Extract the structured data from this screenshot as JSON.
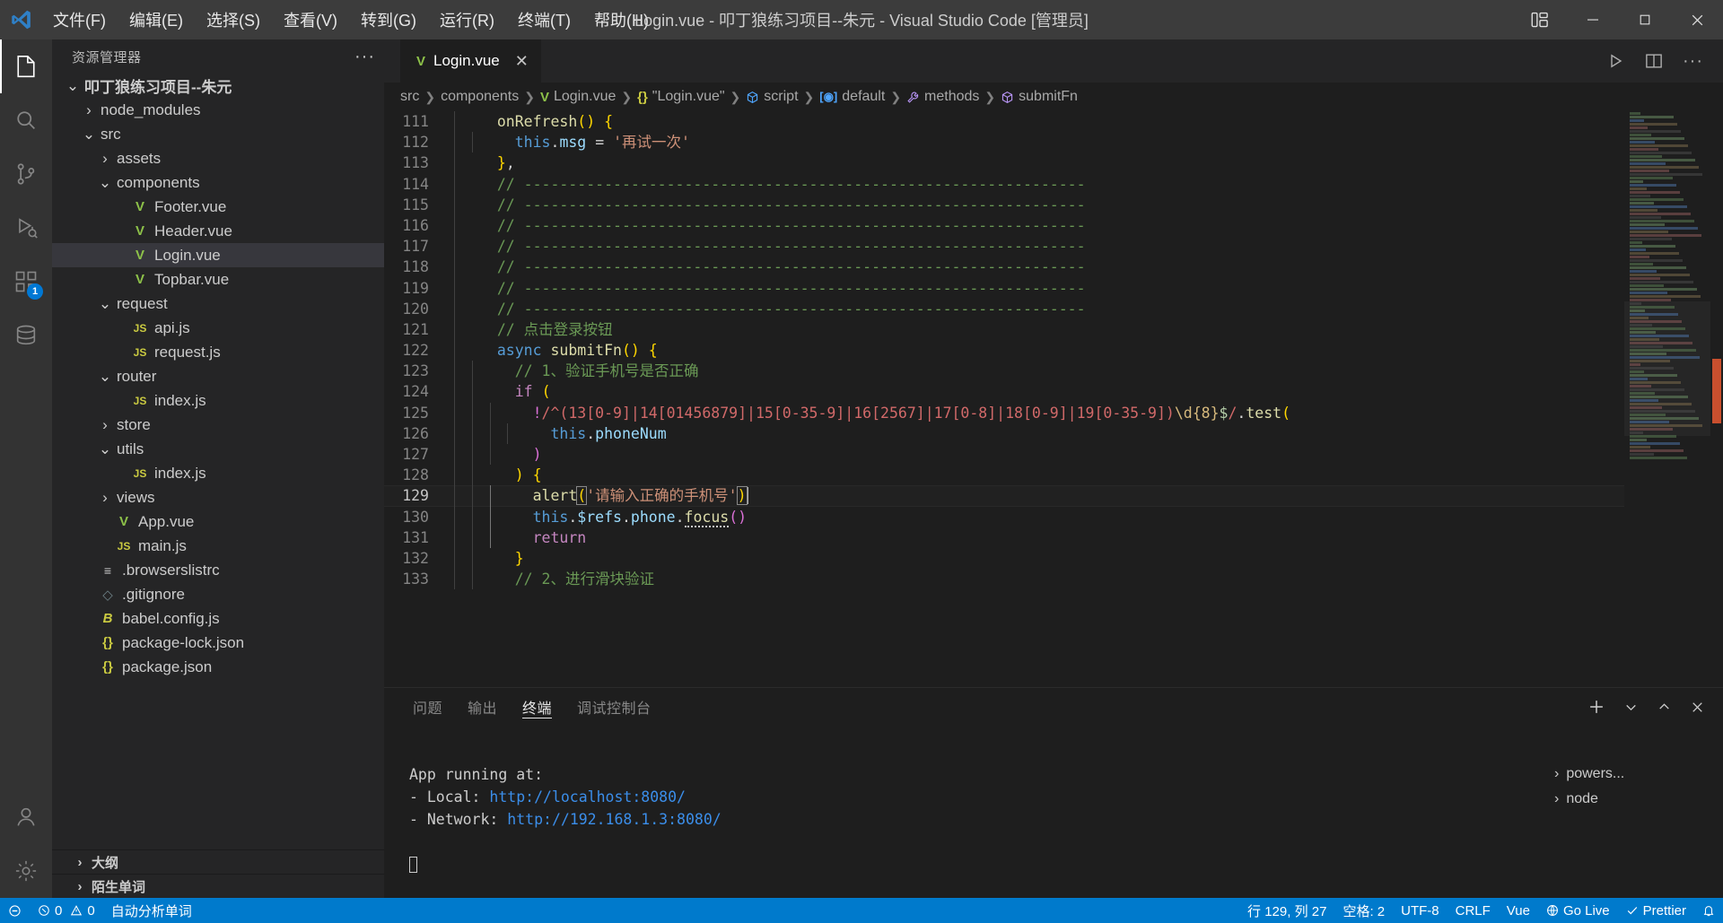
{
  "titlebar": {
    "menus": [
      "文件(F)",
      "编辑(E)",
      "选择(S)",
      "查看(V)",
      "转到(G)",
      "运行(R)",
      "终端(T)",
      "帮助(H)"
    ],
    "title": "Login.vue - 叩丁狼练习项目--朱元 - Visual Studio Code [管理员]",
    "controls": {
      "layout": "layout-icon",
      "minimize": "─",
      "maximize": "▢",
      "close": "✕"
    }
  },
  "activitybar": {
    "items": [
      {
        "name": "explorer-icon",
        "label": "资源管理器",
        "active": true,
        "badge": ""
      },
      {
        "name": "search-icon",
        "label": "搜索",
        "active": false,
        "badge": ""
      },
      {
        "name": "source-control-icon",
        "label": "源代码管理",
        "active": false,
        "badge": ""
      },
      {
        "name": "run-debug-icon",
        "label": "运行和调试",
        "active": false,
        "badge": ""
      },
      {
        "name": "extensions-icon",
        "label": "扩展",
        "active": false,
        "badge": "1"
      },
      {
        "name": "remote-explorer-icon",
        "label": "远程资源管理器",
        "active": false,
        "badge": ""
      }
    ],
    "bottom": [
      {
        "name": "account-icon",
        "label": "账户"
      },
      {
        "name": "gear-icon",
        "label": "管理"
      }
    ]
  },
  "sidebar": {
    "header": "资源管理器",
    "header_more": "···",
    "tree": [
      {
        "label": "叩丁狼练习项目--朱元",
        "indent": 0,
        "twisty": "down",
        "icon": "",
        "bold": true,
        "selected": false
      },
      {
        "label": "node_modules",
        "indent": 1,
        "twisty": "right",
        "icon": "",
        "bold": false,
        "selected": false
      },
      {
        "label": "src",
        "indent": 1,
        "twisty": "down",
        "icon": "",
        "bold": false,
        "selected": false
      },
      {
        "label": "assets",
        "indent": 2,
        "twisty": "right",
        "icon": "",
        "bold": false,
        "selected": false
      },
      {
        "label": "components",
        "indent": 2,
        "twisty": "down",
        "icon": "",
        "bold": false,
        "selected": false
      },
      {
        "label": "Footer.vue",
        "indent": 3,
        "twisty": "",
        "icon": "vue",
        "bold": false,
        "selected": false
      },
      {
        "label": "Header.vue",
        "indent": 3,
        "twisty": "",
        "icon": "vue",
        "bold": false,
        "selected": false
      },
      {
        "label": "Login.vue",
        "indent": 3,
        "twisty": "",
        "icon": "vue",
        "bold": false,
        "selected": true
      },
      {
        "label": "Topbar.vue",
        "indent": 3,
        "twisty": "",
        "icon": "vue",
        "bold": false,
        "selected": false
      },
      {
        "label": "request",
        "indent": 2,
        "twisty": "down",
        "icon": "",
        "bold": false,
        "selected": false
      },
      {
        "label": "api.js",
        "indent": 3,
        "twisty": "",
        "icon": "js",
        "bold": false,
        "selected": false
      },
      {
        "label": "request.js",
        "indent": 3,
        "twisty": "",
        "icon": "js",
        "bold": false,
        "selected": false
      },
      {
        "label": "router",
        "indent": 2,
        "twisty": "down",
        "icon": "",
        "bold": false,
        "selected": false
      },
      {
        "label": "index.js",
        "indent": 3,
        "twisty": "",
        "icon": "js",
        "bold": false,
        "selected": false
      },
      {
        "label": "store",
        "indent": 2,
        "twisty": "right",
        "icon": "",
        "bold": false,
        "selected": false
      },
      {
        "label": "utils",
        "indent": 2,
        "twisty": "down",
        "icon": "",
        "bold": false,
        "selected": false
      },
      {
        "label": "index.js",
        "indent": 3,
        "twisty": "",
        "icon": "js",
        "bold": false,
        "selected": false
      },
      {
        "label": "views",
        "indent": 2,
        "twisty": "right",
        "icon": "",
        "bold": false,
        "selected": false
      },
      {
        "label": "App.vue",
        "indent": 2,
        "twisty": "",
        "icon": "vue",
        "bold": false,
        "selected": false
      },
      {
        "label": "main.js",
        "indent": 2,
        "twisty": "",
        "icon": "js",
        "bold": false,
        "selected": false
      },
      {
        "label": ".browserslistrc",
        "indent": 1,
        "twisty": "",
        "icon": "cfg",
        "bold": false,
        "selected": false
      },
      {
        "label": ".gitignore",
        "indent": 1,
        "twisty": "",
        "icon": "git",
        "bold": false,
        "selected": false
      },
      {
        "label": "babel.config.js",
        "indent": 1,
        "twisty": "",
        "icon": "babel",
        "bold": false,
        "selected": false
      },
      {
        "label": "package-lock.json",
        "indent": 1,
        "twisty": "",
        "icon": "json",
        "bold": false,
        "selected": false
      },
      {
        "label": "package.json",
        "indent": 1,
        "twisty": "",
        "icon": "json",
        "bold": false,
        "selected": false
      }
    ],
    "sections": [
      {
        "label": "大纲",
        "twisty": "right"
      },
      {
        "label": "陌生单词",
        "twisty": "right"
      }
    ]
  },
  "editor": {
    "tab": {
      "label": "Login.vue",
      "icon": "vue-icon",
      "close": "✕"
    },
    "tab_actions": [
      "run-icon",
      "split-editor-icon",
      "more-actions-icon"
    ],
    "breadcrumbs": [
      {
        "label": "src",
        "icon": ""
      },
      {
        "label": "components",
        "icon": ""
      },
      {
        "label": "Login.vue",
        "icon": "vue"
      },
      {
        "label": "\"Login.vue\"",
        "icon": "json"
      },
      {
        "label": "script",
        "icon": "cube-blue"
      },
      {
        "label": "default",
        "icon": "field"
      },
      {
        "label": "methods",
        "icon": "wrench"
      },
      {
        "label": "submitFn",
        "icon": "cube-purple"
      }
    ],
    "first_line": 111,
    "current_line": 129,
    "lines": [
      {
        "n": 111,
        "text": "  onRefresh() {"
      },
      {
        "n": 112,
        "text": "    this.msg = '再试一次'"
      },
      {
        "n": 113,
        "text": "  },"
      },
      {
        "n": 114,
        "text": "  // ---------------------------------------------------------------"
      },
      {
        "n": 115,
        "text": "  // ---------------------------------------------------------------"
      },
      {
        "n": 116,
        "text": "  // ---------------------------------------------------------------"
      },
      {
        "n": 117,
        "text": "  // ---------------------------------------------------------------"
      },
      {
        "n": 118,
        "text": "  // ---------------------------------------------------------------"
      },
      {
        "n": 119,
        "text": "  // ---------------------------------------------------------------"
      },
      {
        "n": 120,
        "text": "  // ---------------------------------------------------------------"
      },
      {
        "n": 121,
        "text": "  // 点击登录按钮"
      },
      {
        "n": 122,
        "text": "  async submitFn() {"
      },
      {
        "n": 123,
        "text": "    // 1、验证手机号是否正确"
      },
      {
        "n": 124,
        "text": "    if ("
      },
      {
        "n": 125,
        "text": "      !/^(13[0-9]|14[01456879]|15[0-35-9]|16[2567]|17[0-8]|18[0-9]|19[0-35-9])\\d{8}$/.test("
      },
      {
        "n": 126,
        "text": "        this.phoneNum"
      },
      {
        "n": 127,
        "text": "      )"
      },
      {
        "n": 128,
        "text": "    ) {"
      },
      {
        "n": 129,
        "text": "      alert('请输入正确的手机号')"
      },
      {
        "n": 130,
        "text": "      this.$refs.phone.focus()"
      },
      {
        "n": 131,
        "text": "      return"
      },
      {
        "n": 132,
        "text": "    }"
      },
      {
        "n": 133,
        "text": "    // 2、进行滑块验证"
      }
    ]
  },
  "panel": {
    "tabs": [
      {
        "label": "问题",
        "active": false
      },
      {
        "label": "输出",
        "active": false
      },
      {
        "label": "终端",
        "active": true
      },
      {
        "label": "调试控制台",
        "active": false
      }
    ],
    "actions": [
      "add-terminal-icon",
      "chevron-down-icon",
      "maximize-panel-icon",
      "close-panel-icon"
    ],
    "terminal": {
      "heading": "App running at:",
      "rows": [
        {
          "label": "- Local:  ",
          "url": "http://localhost:8080/"
        },
        {
          "label": "- Network:",
          "url": "http://192.168.1.3:8080/"
        }
      ]
    },
    "terminal_list": [
      {
        "label": "powers...",
        "active": false
      },
      {
        "label": "node",
        "active": false
      }
    ]
  },
  "statusbar": {
    "left": [
      {
        "name": "remote-indicator",
        "icon": "remote-icon",
        "text": ""
      },
      {
        "name": "problems",
        "icon": "error-warning",
        "text": "0  0"
      },
      {
        "name": "auto-analyze-words",
        "icon": "",
        "text": "自动分析单词"
      }
    ],
    "right": [
      {
        "name": "cursor-position",
        "text": "行 129, 列 27"
      },
      {
        "name": "indentation",
        "text": "空格: 2"
      },
      {
        "name": "encoding",
        "text": "UTF-8"
      },
      {
        "name": "eol",
        "text": "CRLF"
      },
      {
        "name": "language-mode",
        "text": "Vue"
      },
      {
        "name": "go-live",
        "text": "Go Live"
      },
      {
        "name": "prettier",
        "text": "Prettier"
      }
    ],
    "accent": "#007acc"
  }
}
